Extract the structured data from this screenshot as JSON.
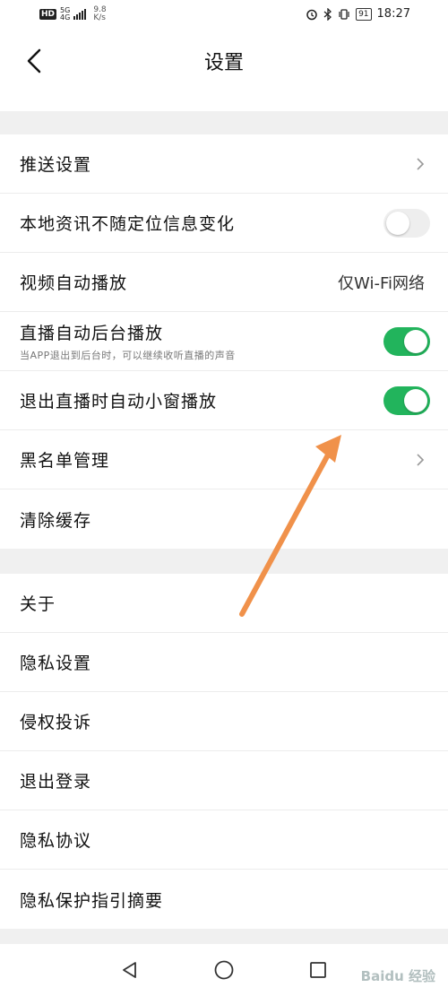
{
  "status_bar": {
    "hd": "HD",
    "network_top": "5G",
    "network_bottom": "4G",
    "speed_value": "9.8",
    "speed_unit": "K/s",
    "battery": "91",
    "time": "18:27"
  },
  "header": {
    "title": "设置"
  },
  "groups": {
    "push_settings": "推送设置",
    "local_news": "本地资讯不随定位信息变化",
    "local_news_toggle": "off",
    "video_autoplay": "视频自动播放",
    "video_autoplay_value": "仅Wi-Fi网络",
    "live_bg": "直播自动后台播放",
    "live_bg_sub": "当APP退出到后台时，可以继续收听直播的声音",
    "live_bg_toggle": "on",
    "live_pip": "退出直播时自动小窗播放",
    "live_pip_toggle": "on",
    "blacklist": "黑名单管理",
    "clear_cache": "清除缓存"
  },
  "about_group": {
    "about": "关于",
    "privacy_settings": "隐私设置",
    "infringement": "侵权投诉",
    "logout": "退出登录",
    "privacy_policy": "隐私协议",
    "privacy_guide": "隐私保护指引摘要"
  },
  "watermark": "Baidu 经验",
  "colors": {
    "toggle_on": "#22b45c",
    "toggle_off": "#eeeeee",
    "annotation_arrow": "#f0914a"
  }
}
